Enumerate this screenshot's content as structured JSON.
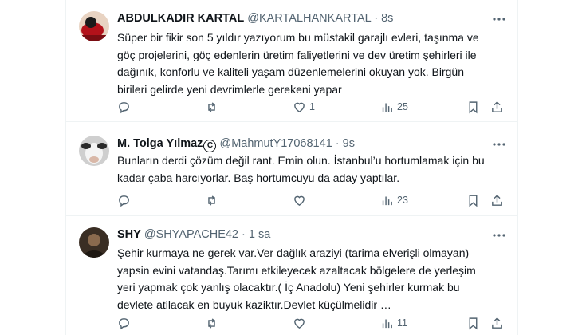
{
  "tweets": [
    {
      "name": "ABDULKADIR KARTAL",
      "handle": "@KARTALHANKARTAL",
      "dot": "·",
      "time": "8s",
      "lines": [
        "Süper bir fikir son 5 yıldır yazıyorum  bu müstakil garajlı evleri, taşınma ve",
        "göç projelerini, göç edenlerin üretim faliyetlerini ve dev  üretim şehirleri ile",
        "dağınık, konforlu ve kaliteli yaşam düzenlemelerini okuyan yok. Birgün",
        "birileri gelirde yeni devrimlerle gerekeni yapar"
      ],
      "likes": "1",
      "views": "25"
    },
    {
      "name": "M. Tolga Yılmaz",
      "verified_mark": "C",
      "handle": "@MahmutY17068141",
      "dot": "·",
      "time": "9s",
      "lines": [
        "Bunların derdi çözüm değil rant. Emin olun. İstanbul’u hortumlamak için bu",
        "kadar çaba harcıyorlar. Baş hortumcuyu da aday yaptılar."
      ],
      "views": "23"
    },
    {
      "name": "SHY",
      "handle": "@SHYAPACHE42",
      "dot": "·",
      "time": "1 sa",
      "lines": [
        "Şehir kurmaya ne gerek var.Ver dağlık araziyi (tarima elverişli olmayan)",
        "yapsin evini vatandaş.Tarımı etkileyecek azaltacak bölgelere de yerleşim",
        "yeri yapmak çok yanlış olacaktır.( İç Anadolu) Yeni şehirler kurmak bu",
        "devlete atilacak en buyuk kaziktır.Devlet küçülmelidir …"
      ],
      "views": "11"
    }
  ],
  "icons": [
    "more-icon",
    "reply-icon",
    "retweet-icon",
    "like-icon",
    "views-icon",
    "bookmark-icon",
    "share-icon"
  ],
  "colors": {
    "text": "#0f1419",
    "secondary": "#536471",
    "border": "#eff3f4"
  }
}
